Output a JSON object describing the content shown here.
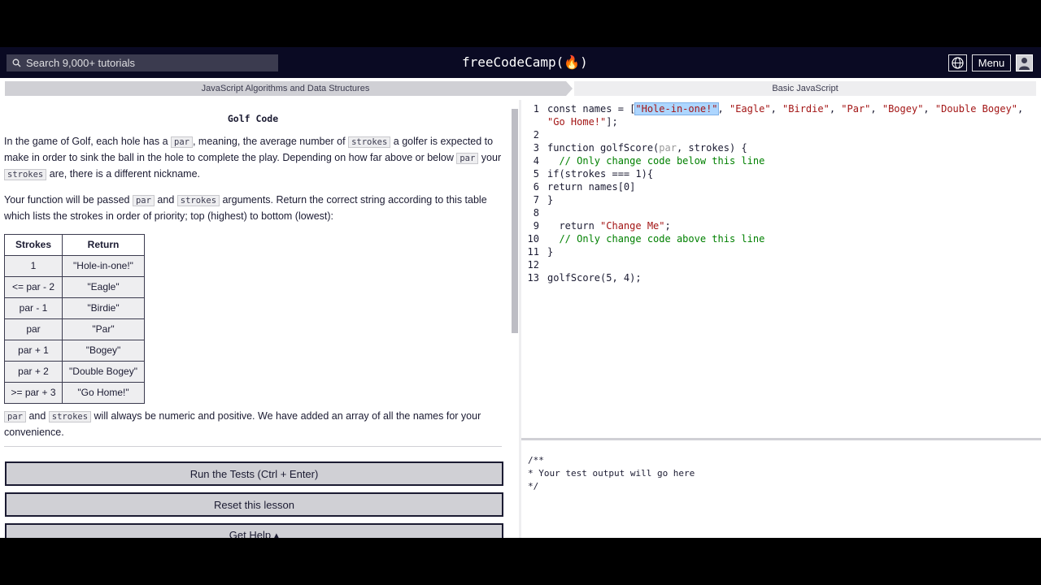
{
  "nav": {
    "search_placeholder": "Search 9,000+ tutorials",
    "logo": "freeCodeCamp(🔥)",
    "menu_label": "Menu"
  },
  "breadcrumb": {
    "superblock": "JavaScript Algorithms and Data Structures",
    "block": "Basic JavaScript"
  },
  "challenge": {
    "title": "Golf Code",
    "p1": {
      "t1": "In the game of Golf, each hole has a ",
      "c1": "par",
      "t2": ", meaning, the average number of ",
      "c2": "strokes",
      "t3": " a golfer is expected to make in order to sink the ball in the hole to complete the play. Depending on how far above or below ",
      "c3": "par",
      "t4": " your ",
      "c4": "strokes",
      "t5": " are, there is a different nickname."
    },
    "p2": {
      "t1": "Your function will be passed ",
      "c1": "par",
      "t2": " and ",
      "c2": "strokes",
      "t3": " arguments. Return the correct string according to this table which lists the strokes in order of priority; top (highest) to bottom (lowest):"
    },
    "table": {
      "headers": [
        "Strokes",
        "Return"
      ],
      "rows": [
        [
          "1",
          "\"Hole-in-one!\""
        ],
        [
          "<= par - 2",
          "\"Eagle\""
        ],
        [
          "par - 1",
          "\"Birdie\""
        ],
        [
          "par",
          "\"Par\""
        ],
        [
          "par + 1",
          "\"Bogey\""
        ],
        [
          "par + 2",
          "\"Double Bogey\""
        ],
        [
          ">= par + 3",
          "\"Go Home!\""
        ]
      ]
    },
    "p3": {
      "c1": "par",
      "t1": " and ",
      "c2": "strokes",
      "t2": " will always be numeric and positive. We have added an array of all the names for your convenience."
    }
  },
  "buttons": {
    "run": "Run the Tests (Ctrl + Enter)",
    "reset": "Reset this lesson",
    "help": "Get Help ▴"
  },
  "editor": {
    "line_numbers": [
      "1",
      "",
      "2",
      "3",
      "4",
      "5",
      "6",
      "7",
      "8",
      "9",
      "10",
      "11",
      "12",
      "13"
    ],
    "code": {
      "l1_a": "const names = [",
      "l1_hl": "\"Hole-in-one!\"",
      "l1_b": ", ",
      "l1_s1": "\"Eagle\"",
      "l1_c1": ", ",
      "l1_s2": "\"Birdie\"",
      "l1_c2": ", ",
      "l1_s3": "\"Par\"",
      "l1_c3": ", ",
      "l1_s4": "\"Bogey\"",
      "l1_c4": ", ",
      "l1_s5": "\"Double Bogey\"",
      "l1_c5": ",",
      "l1w_s": "\"Go Home!\"",
      "l1w_e": "];",
      "l3_a": "function golfScore(",
      "l3_p": "par",
      "l3_b": ", strokes) {",
      "l4": "  // Only change code below this line",
      "l5": "if(strokes === 1){",
      "l6": "return names[0]",
      "l7": "}",
      "l9_a": "  return ",
      "l9_s": "\"Change Me\"",
      "l9_b": ";",
      "l10": "  // Only change code above this line",
      "l11": "}",
      "l13": "golfScore(5, 4);"
    }
  },
  "console": {
    "text": "/**\n* Your test output will go here\n*/"
  }
}
